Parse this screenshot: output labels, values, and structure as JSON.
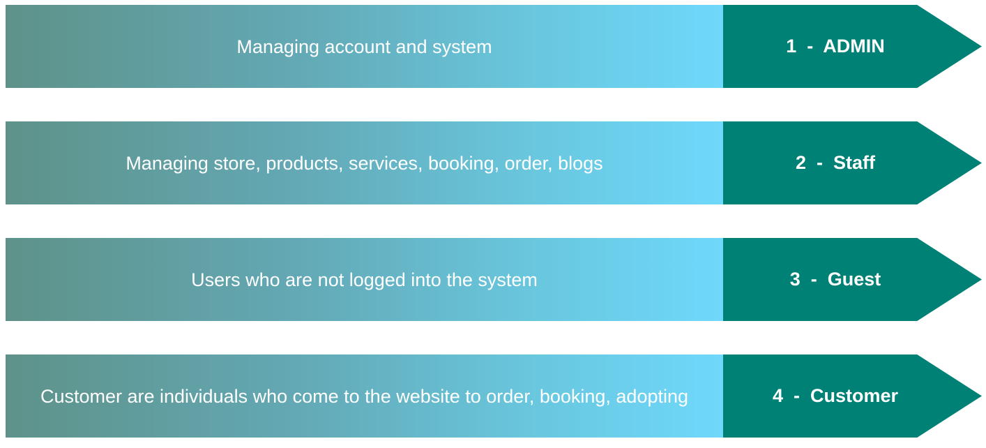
{
  "rows": [
    {
      "description": "Managing account and system",
      "role": "1  -  ADMIN"
    },
    {
      "description": "Managing store, products, services, booking, order, blogs",
      "role": "2  -  Staff"
    },
    {
      "description": "Users who are not logged into the system",
      "role": "3  -  Guest"
    },
    {
      "description": "Customer are individuals who come to the website to order, booking, adopting",
      "role": "4  -  Customer"
    }
  ],
  "colors": {
    "role_arrow": "#008176",
    "gradient_start": "#5e9289",
    "gradient_end": "#6fd8fb",
    "text": "#ffffff"
  }
}
